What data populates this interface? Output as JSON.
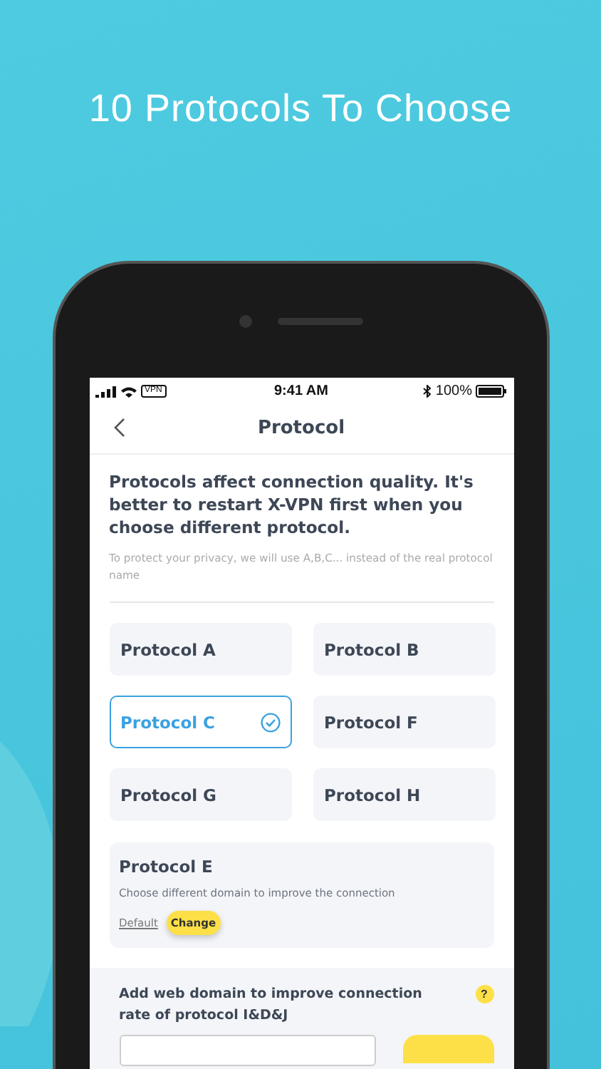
{
  "headline": "10 Protocols To Choose",
  "status_bar": {
    "time": "9:41 AM",
    "vpn": "VPN",
    "battery": "100%"
  },
  "nav": {
    "title": "Protocol"
  },
  "intro": "Protocols affect connection quality. It's better to restart X-VPN first when you choose different protocol.",
  "privacy_note": "To protect your privacy, we will use A,B,C... instead of the real protocol name",
  "protocols": [
    {
      "name": "Protocol A",
      "selected": false
    },
    {
      "name": "Protocol B",
      "selected": false
    },
    {
      "name": "Protocol C",
      "selected": true
    },
    {
      "name": "Protocol F",
      "selected": false
    },
    {
      "name": "Protocol G",
      "selected": false
    },
    {
      "name": "Protocol H",
      "selected": false
    }
  ],
  "protocol_e": {
    "name": "Protocol E",
    "description": "Choose different domain to improve the connection",
    "options": [
      {
        "label": "Default",
        "selected": false
      },
      {
        "label": "Change",
        "selected": true
      }
    ]
  },
  "domain_section": {
    "text": "Add web domain to improve connection rate of protocol I&D&J",
    "help": "?"
  }
}
